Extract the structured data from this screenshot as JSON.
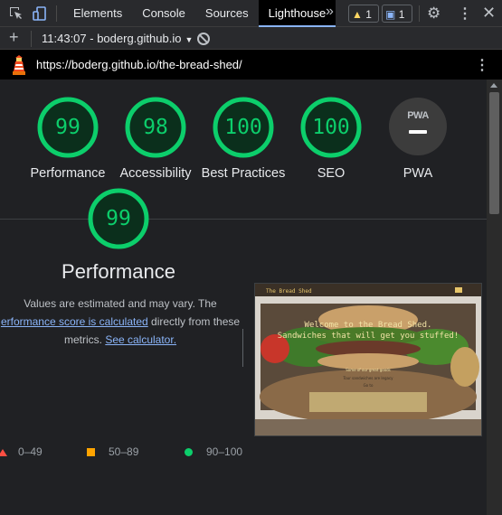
{
  "devtools": {
    "tabs": [
      "Elements",
      "Console",
      "Sources",
      "Lighthouse"
    ],
    "more_tabs_icon": "chevron-double-right-icon",
    "warnings_count": "1",
    "messages_count": "1",
    "icons": [
      "inspect-element-icon",
      "device-toggle-icon",
      "warning-icon",
      "message-icon",
      "gear-icon",
      "kebab-icon",
      "close-icon"
    ]
  },
  "report_bar": {
    "selected_report": "11:43:07 - boderg.github.io",
    "icons": [
      "plus-icon",
      "clear-icon"
    ]
  },
  "url_bar": {
    "url": "https://boderg.github.io/the-bread-shed/"
  },
  "scores": [
    {
      "label": "Performance",
      "score": "99"
    },
    {
      "label": "Accessibility",
      "score": "98"
    },
    {
      "label": "Best Practices",
      "score": "100"
    },
    {
      "label": "SEO",
      "score": "100"
    },
    {
      "label": "PWA",
      "score": ""
    }
  ],
  "pwa_badge_text": "PWA",
  "performance": {
    "score": "99",
    "title": "Performance",
    "desc_line1": "Values are estimated and may vary. The",
    "desc_link1": "erformance score is calculated",
    "desc_after_link": " directly from these",
    "desc_line3_prefix": "metrics. ",
    "desc_link2": "See calculator."
  },
  "screenshot": {
    "site_logo": "The Bread Shed",
    "headline1": "Welcome to the Bread Shed.",
    "headline2": "Sandwiches that will get you stuffed!",
    "box_line1": "Some of our great goods",
    "box_line2": "Tour sandwiches are legacy",
    "box_btn": "Go to"
  },
  "legend": {
    "fail": "0–49",
    "average": "50–89",
    "pass": "90–100"
  },
  "colors": {
    "pass": "#0cce6b",
    "average": "#ffa400",
    "fail": "#ff4e42",
    "link": "#8ab4f8"
  }
}
